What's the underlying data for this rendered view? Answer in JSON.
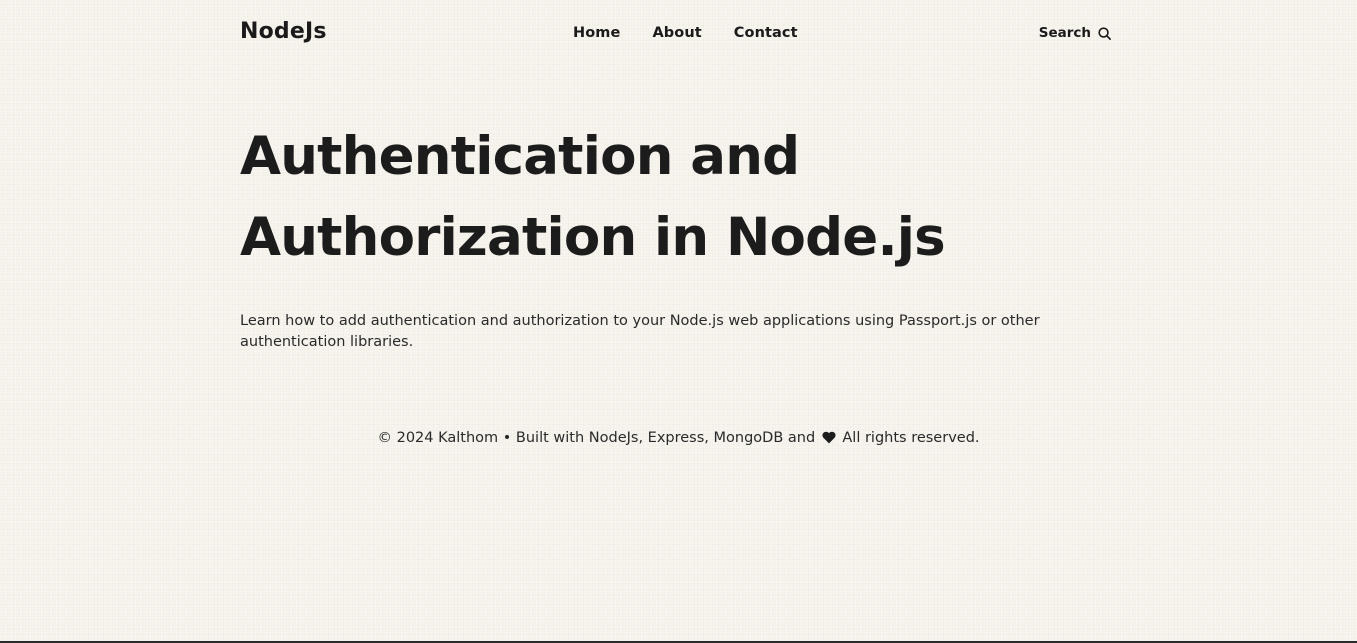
{
  "header": {
    "logo": "NodeJs",
    "nav": [
      {
        "label": "Home"
      },
      {
        "label": "About"
      },
      {
        "label": "Contact"
      }
    ],
    "search_label": "Search",
    "search_icon": "search-icon"
  },
  "hero": {
    "title": "Authentication and Authorization in Node.js",
    "description": "Learn how to add authentication and authorization to your Node.js web applications using Passport.js or other authentication libraries."
  },
  "footer": {
    "text_before": "© 2024 Kalthom • Built with NodeJs, Express, MongoDB and",
    "heart_icon": "heart-icon",
    "text_after": "All rights reserved."
  },
  "colors": {
    "background": "#f8f4ee",
    "text": "#1c1c1c"
  }
}
